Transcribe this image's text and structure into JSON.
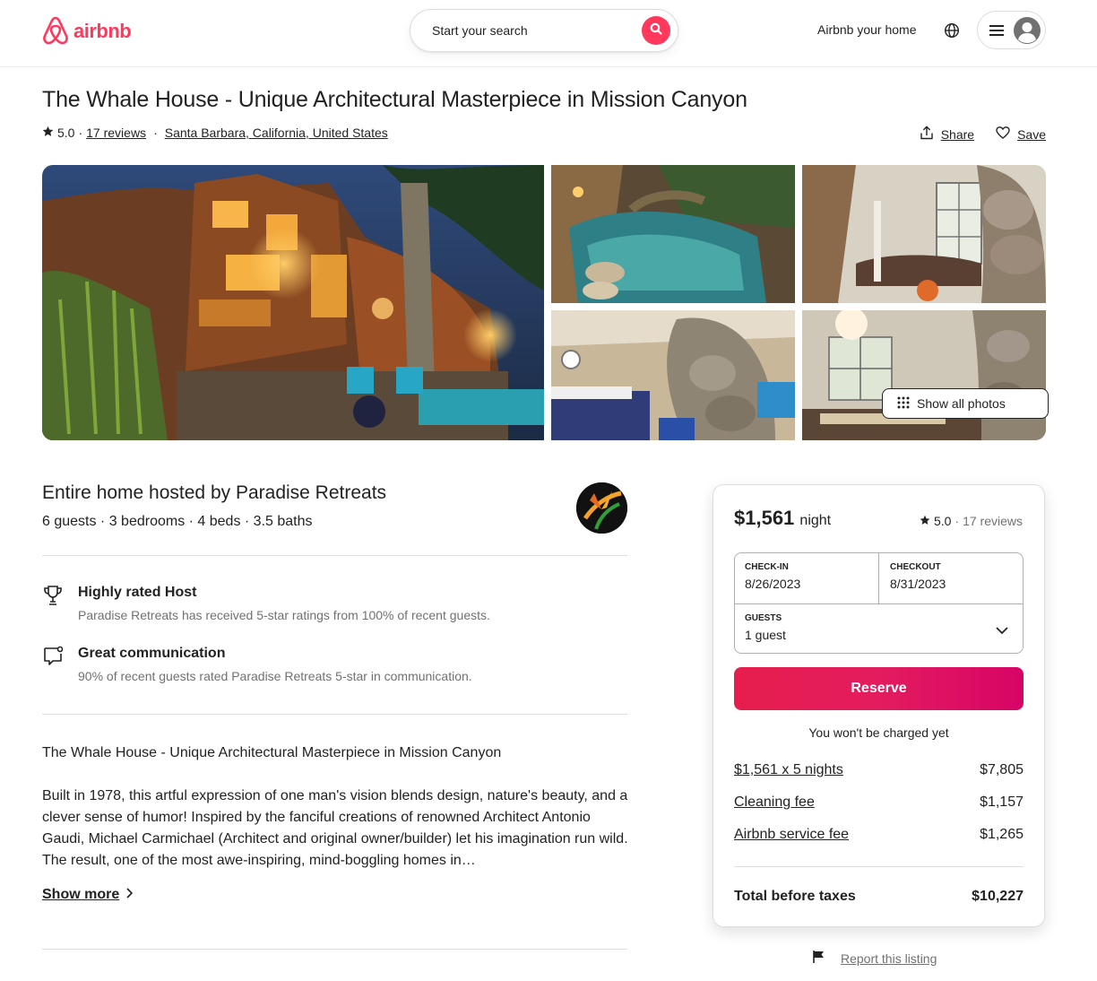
{
  "header": {
    "logo_text": "airbnb",
    "search_placeholder": "Start your search",
    "host_link": "Airbnb your home",
    "brand_color": "#ff385c",
    "icons": [
      "airbnb-logo-icon",
      "search-icon",
      "globe-icon",
      "menu-icon",
      "user-avatar-icon"
    ]
  },
  "listing": {
    "title": "The Whale House - Unique Architectural Masterpiece in Mission Canyon",
    "rating": "5.0",
    "reviews": "17 reviews",
    "location": "Santa Barbara, California, United States",
    "share_label": "Share",
    "save_label": "Save",
    "show_all_photos": "Show all photos"
  },
  "host": {
    "hosted_by": "Entire home hosted by Paradise Retreats",
    "specs": "6 guests · 3 bedrooms · 4 beds · 3.5 baths"
  },
  "highlights": [
    {
      "icon": "trophy-icon",
      "title": "Highly rated Host",
      "desc": "Paradise Retreats has received 5-star ratings from 100% of recent guests."
    },
    {
      "icon": "chat-bubble-icon",
      "title": "Great communication",
      "desc": "90% of recent guests rated Paradise Retreats 5-star in communication."
    }
  ],
  "description": {
    "heading": "The Whale House - Unique Architectural Masterpiece in Mission Canyon",
    "body": "Built in 1978, this artful expression of one man's vision blends design, nature's beauty, and a clever sense of humor!  Inspired by the fanciful creations of renowned Architect Antonio Gaudi, Michael Carmichael (Architect and original owner/builder) let his imagination run wild.  The result, one of the most awe-inspiring, mind-boggling homes in…",
    "show_more": "Show more"
  },
  "booking": {
    "price": "$1,561",
    "per": "night",
    "rating": "5.0",
    "reviews": "17 reviews",
    "checkin_label": "CHECK-IN",
    "checkin": "8/26/2023",
    "checkout_label": "CHECKOUT",
    "checkout": "8/31/2023",
    "guests_label": "GUESTS",
    "guests": "1 guest",
    "reserve": "Reserve",
    "no_charge": "You won't be charged yet",
    "fees": [
      {
        "label": "$1,561 x 5 nights",
        "amount": "$7,805"
      },
      {
        "label": "Cleaning fee",
        "amount": "$1,157"
      },
      {
        "label": "Airbnb service fee",
        "amount": "$1,265"
      }
    ],
    "total_label": "Total before taxes",
    "total": "$10,227"
  },
  "report": "Report this listing"
}
